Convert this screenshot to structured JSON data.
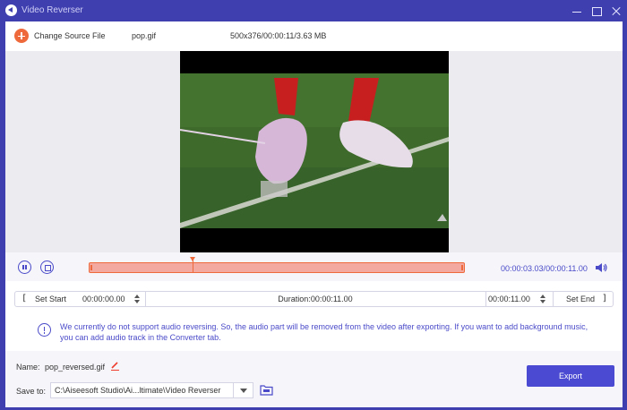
{
  "window": {
    "title": "Video Reverser",
    "controls": [
      "minimize-icon",
      "maximize-icon",
      "close-icon"
    ]
  },
  "source": {
    "change_label": "Change Source File",
    "file_name": "pop.gif",
    "file_info": "500x376/00:00:11/3.63 MB"
  },
  "playback": {
    "current_time": "00:00:03.03",
    "total_time": "00:00:11.00",
    "progress_fraction": 0.275
  },
  "trim": {
    "set_start_label": "Set Start",
    "start_time": "00:00:00.00",
    "duration": "Duration:00:00:11.00",
    "end_time": "00:00:11.00",
    "set_end_label": "Set End",
    "bracket_open": "[",
    "bracket_close": "]"
  },
  "notice": {
    "text": "We currently do not support audio reversing. So, the audio part will be removed from the video after exporting. If you want to add background music, you can add audio track in the Converter tab."
  },
  "output": {
    "name_label": "Name:",
    "name_value": "pop_reversed.gif",
    "save_to_label": "Save to:",
    "save_path": "C:\\Aiseesoft Studio\\Ai...ltimate\\Video Reverser",
    "export_label": "Export"
  },
  "colors": {
    "titlebar": "#3f3fb0",
    "accent": "#4a4ad2",
    "trim_fill": "#f4a9a0",
    "trim_border": "#ee6a3c"
  }
}
